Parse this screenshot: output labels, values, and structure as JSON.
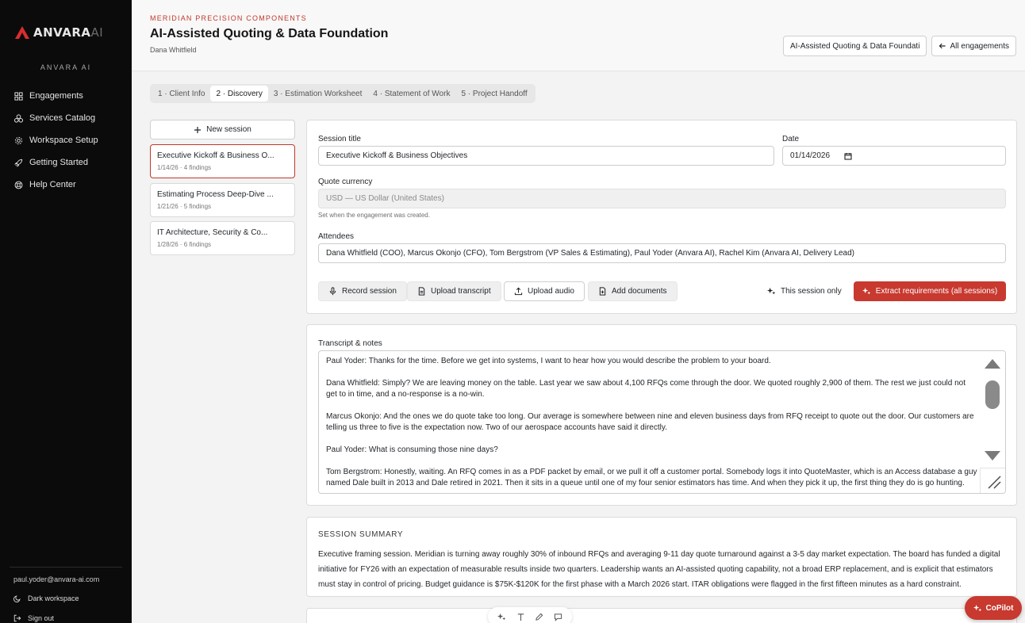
{
  "sidebar": {
    "brand_name": "ANVARA AI",
    "logo_text": "ANVARA",
    "logo_suffix": "AI",
    "nav": [
      {
        "label": "Engagements",
        "icon": "grid-icon"
      },
      {
        "label": "Services Catalog",
        "icon": "cubes-icon"
      },
      {
        "label": "Workspace Setup",
        "icon": "gear-icon"
      },
      {
        "label": "Getting Started",
        "icon": "rocket-icon"
      },
      {
        "label": "Help Center",
        "icon": "lifebuoy-icon"
      }
    ],
    "user_email": "paul.yoder@anvara-ai.com",
    "dark_workspace_label": "Dark workspace",
    "sign_out_label": "Sign out"
  },
  "header": {
    "client_name": "MERIDIAN PRECISION COMPONENTS",
    "title": "AI-Assisted Quoting & Data Foundation",
    "subtitle": "Dana Whitfield",
    "engagement_select": "AI-Assisted Quoting & Data Foundati",
    "all_engagements_label": "All engagements"
  },
  "steps": [
    {
      "label": "1 · Client Info",
      "active": false
    },
    {
      "label": "2 · Discovery",
      "active": true
    },
    {
      "label": "3 · Estimation Worksheet",
      "active": false
    },
    {
      "label": "4 · Statement of Work",
      "active": false
    },
    {
      "label": "5 · Project Handoff",
      "active": false
    }
  ],
  "sessions": {
    "new_label": "New session",
    "items": [
      {
        "title": "Executive Kickoff & Business O...",
        "meta": "1/14/26 · 4 findings",
        "active": true
      },
      {
        "title": "Estimating Process Deep-Dive ...",
        "meta": "1/21/26 · 5 findings",
        "active": false
      },
      {
        "title": "IT Architecture, Security & Co...",
        "meta": "1/28/26 · 6 findings",
        "active": false
      }
    ]
  },
  "form": {
    "session_title_label": "Session title",
    "session_title_value": "Executive Kickoff & Business Objectives",
    "date_label": "Date",
    "date_value": "01/14/2026",
    "currency_label": "Quote currency",
    "currency_value": "USD — US Dollar (United States)",
    "currency_hint": "Set when the engagement was created.",
    "attendees_label": "Attendees",
    "attendees_value": "Dana Whitfield (COO), Marcus Okonjo (CFO), Tom Bergstrom (VP Sales & Estimating), Paul Yoder (Anvara AI), Rachel Kim (Anvara AI, Delivery Lead)",
    "record_label": "Record session",
    "upload_transcript_label": "Upload transcript",
    "upload_audio_label": "Upload audio",
    "add_documents_label": "Add documents",
    "this_session_label": "This session only",
    "extract_label": "Extract requirements (all sessions)"
  },
  "transcript": {
    "label": "Transcript & notes",
    "paragraphs": [
      "Paul Yoder: Thanks for the time. Before we get into systems, I want to hear how you would describe the problem to your board.",
      "Dana Whitfield: Simply? We are leaving money on the table. Last year we saw about 4,100 RFQs come through the door. We quoted roughly 2,900 of them. The rest we just could not get to in time, and a no-response is a no-win.",
      "Marcus Okonjo: And the ones we do quote take too long. Our average is somewhere between nine and eleven business days from RFQ receipt to quote out the door. Our customers are telling us three to five is the expectation now. Two of our aerospace accounts have said it directly.",
      "Paul Yoder: What is consuming those nine days?",
      "Tom Bergstrom: Honestly, waiting. An RFQ comes in as a PDF packet by email, or we pull it off a customer portal. Somebody logs it into QuoteMaster, which is an Access database a guy named Dale built in 2013 and Dale retired in 2021. Then it sits in a queue until one of my four senior estimators has time. And when they pick it up, the first thing they do is go hunting."
    ]
  },
  "summary": {
    "heading": "SESSION SUMMARY",
    "text": "Executive framing session. Meridian is turning away roughly 30% of inbound RFQs and averaging 9-11 day quote turnaround against a 3-5 day market expectation. The board has funded a digital initiative for FY26 with an expectation of measurable results inside two quarters. Leadership wants an AI-assisted quoting capability, not a broad ERP replacement, and is explicit that estimators must stay in control of pricing. Budget guidance is $75K-$120K for the first phase with a March 2026 start. ITAR obligations were flagged in the first fifteen minutes as a hard constraint."
  },
  "copilot_label": "CoPilot",
  "colors": {
    "accent": "#c8392f",
    "sidebar_bg": "#0b0b0c"
  }
}
